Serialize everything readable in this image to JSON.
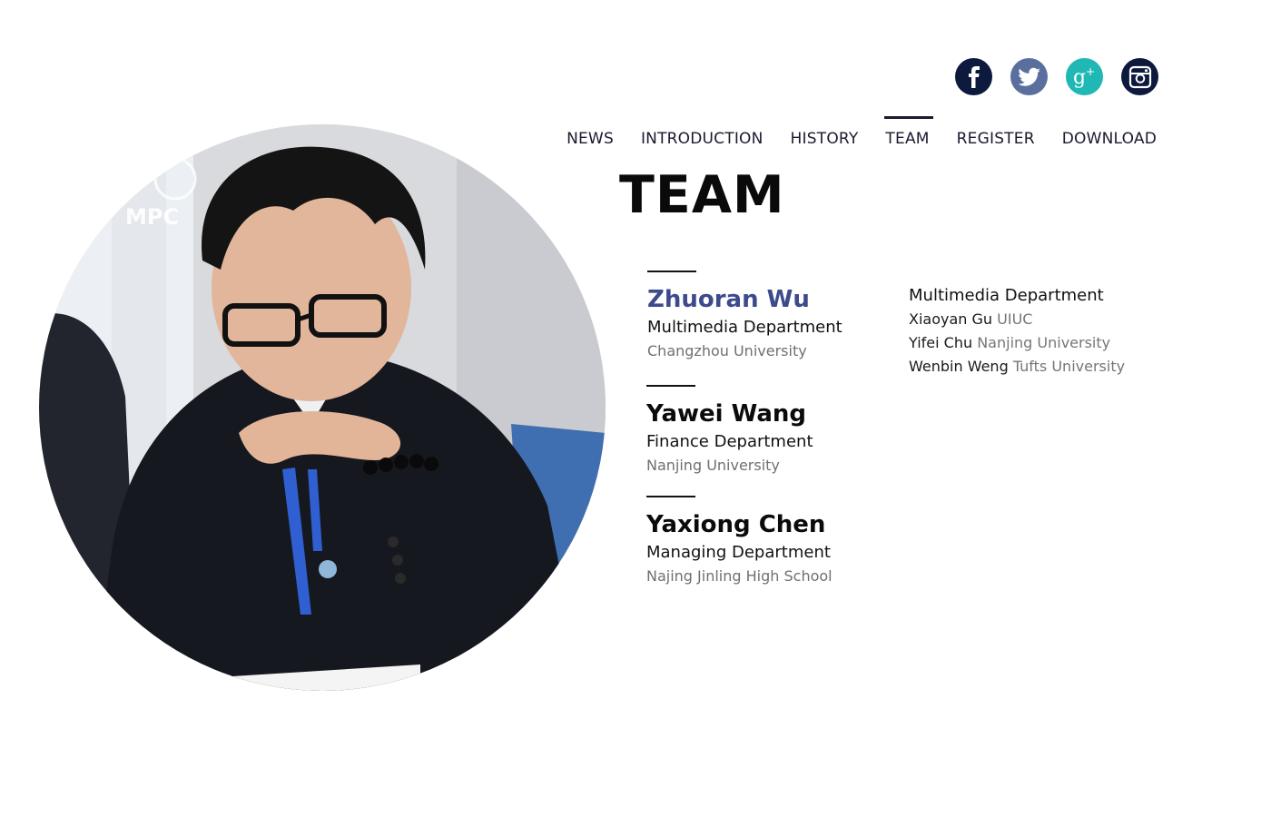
{
  "social": [
    {
      "name": "facebook",
      "icon": "facebook-icon",
      "color": "#0d1a3d"
    },
    {
      "name": "twitter",
      "icon": "twitter-icon",
      "color": "#5a6f9e"
    },
    {
      "name": "google-plus",
      "icon": "google-plus-icon",
      "color": "#1fb8b4"
    },
    {
      "name": "instagram",
      "icon": "instagram-icon",
      "color": "#0d1a3d"
    }
  ],
  "nav": {
    "items": [
      {
        "label": "NEWS"
      },
      {
        "label": "INTRODUCTION"
      },
      {
        "label": "HISTORY"
      },
      {
        "label": "TEAM",
        "active": true
      },
      {
        "label": "REGISTER"
      },
      {
        "label": "DOWNLOAD"
      }
    ]
  },
  "page": {
    "title": "TEAM"
  },
  "members": [
    {
      "name": "Zhuoran Wu",
      "department": "Multimedia Department",
      "school": "Changzhou University",
      "highlight": true
    },
    {
      "name": "Yawei Wang",
      "department": "Finance Department",
      "school": "Nanjing University"
    },
    {
      "name": "Yaxiong Chen",
      "department": "Managing Department",
      "school": "Najing Jinling High School"
    }
  ],
  "side_department": {
    "title": "Multimedia Department",
    "people": [
      {
        "name": "Xiaoyan Gu",
        "school": "UIUC"
      },
      {
        "name": "Yifei Chu",
        "school": "Nanjing University"
      },
      {
        "name": "Wenbin Weng",
        "school": "Tufts University"
      }
    ]
  },
  "colors": {
    "accent": "#3d4a8c",
    "nav_text": "#1a1a2e",
    "muted": "#707070"
  }
}
